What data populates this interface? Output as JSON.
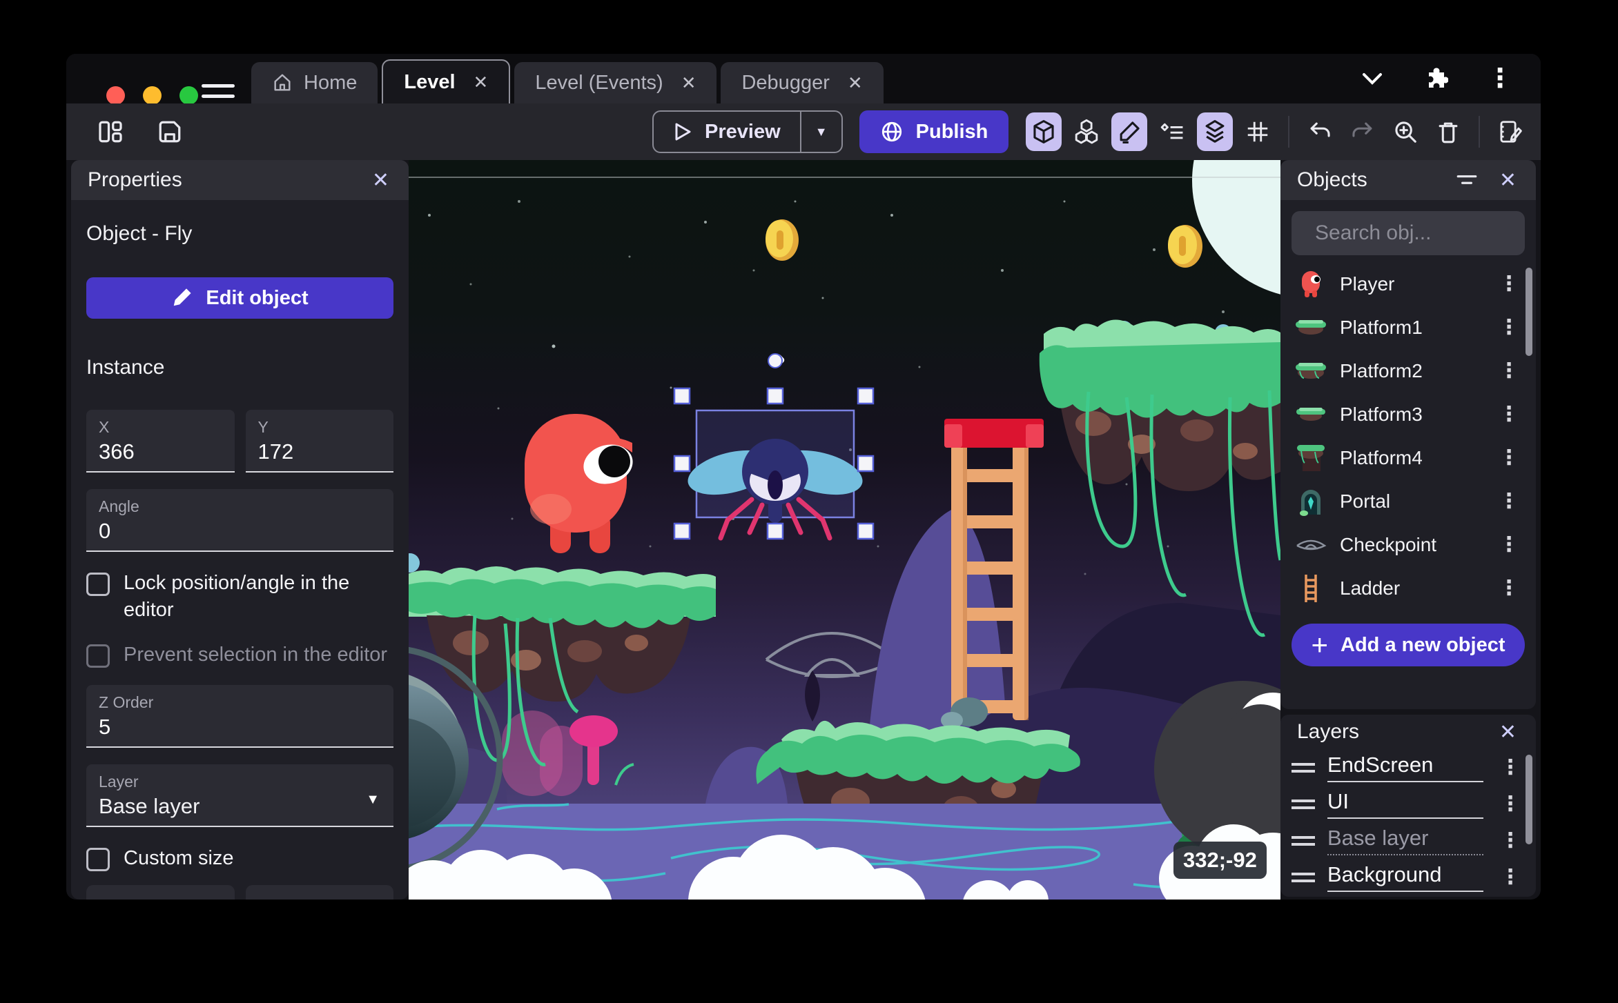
{
  "titlebar": {
    "tabs": {
      "home": "Home",
      "level": "Level",
      "level_events": "Level (Events)",
      "debugger": "Debugger"
    }
  },
  "toolbar": {
    "preview": "Preview",
    "publish": "Publish"
  },
  "properties": {
    "title": "Properties",
    "object_heading": "Object - Fly",
    "edit_object": "Edit object",
    "instance_heading": "Instance",
    "x_label": "X",
    "x_value": "366",
    "y_label": "Y",
    "y_value": "172",
    "angle_label": "Angle",
    "angle_value": "0",
    "lock_label": "Lock position/angle in the editor",
    "prevent_label": "Prevent selection in the editor",
    "zorder_label": "Z Order",
    "zorder_value": "5",
    "layer_label": "Layer",
    "layer_value": "Base layer",
    "custom_size_label": "Custom size"
  },
  "objects": {
    "title": "Objects",
    "search_placeholder": "Search obj...",
    "items": [
      {
        "name": "Player"
      },
      {
        "name": "Platform1"
      },
      {
        "name": "Platform2"
      },
      {
        "name": "Platform3"
      },
      {
        "name": "Platform4"
      },
      {
        "name": "Portal"
      },
      {
        "name": "Checkpoint"
      },
      {
        "name": "Ladder"
      }
    ],
    "add_button": "Add a new object"
  },
  "layers": {
    "title": "Layers",
    "items": [
      {
        "name": "EndScreen"
      },
      {
        "name": "UI"
      },
      {
        "name": "Base layer"
      },
      {
        "name": "Background"
      }
    ]
  },
  "canvas": {
    "coordinate_badge": "332;-92"
  },
  "icons": {
    "close": "✕",
    "kebab": "⋮",
    "caret_down": "▼",
    "plus": "+"
  },
  "colors": {
    "accent": "#4837c8",
    "accent_light": "#c9c1f2",
    "selection": "#7b82e2",
    "coin_gold": "#f0c44a",
    "grass": "#3fbf78",
    "water": "#6b66b4",
    "wave": "#3fc6cf"
  }
}
